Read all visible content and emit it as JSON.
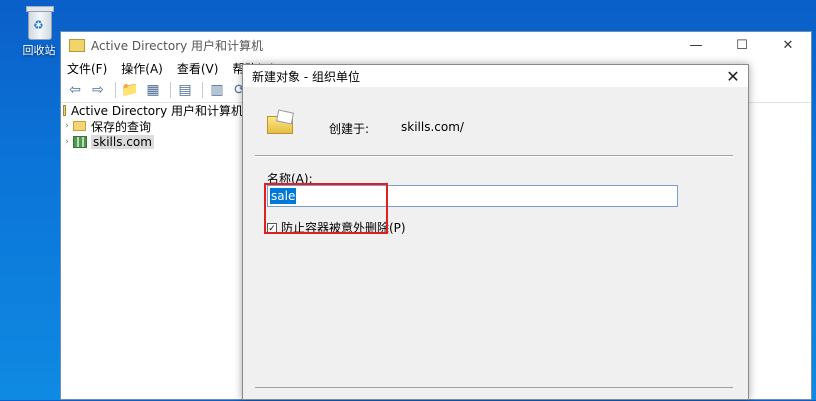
{
  "desktop": {
    "recycle_bin_label": "回收站"
  },
  "main_window": {
    "title": "Active Directory 用户和计算机",
    "controls": {
      "minimize": "—",
      "maximize": "☐",
      "close": "✕"
    },
    "menu": [
      "文件(F)",
      "操作(A)",
      "查看(V)",
      "帮助(H)"
    ],
    "tree": {
      "root": "Active Directory 用户和计算机",
      "items": [
        "保存的查询",
        "skills.com"
      ]
    }
  },
  "dialog": {
    "title": "新建对象 - 组织单位",
    "close": "✕",
    "created_in_label": "创建于:",
    "created_in_value": "skills.com/",
    "name_label": "名称(A):",
    "name_value": "sale",
    "protect_label": "防止容器被意外删除(P)",
    "protect_checked": true
  },
  "colors": {
    "desktop_blue": "#0b74d8",
    "selection_blue": "#0078d7",
    "annotation_red": "#e02020"
  }
}
